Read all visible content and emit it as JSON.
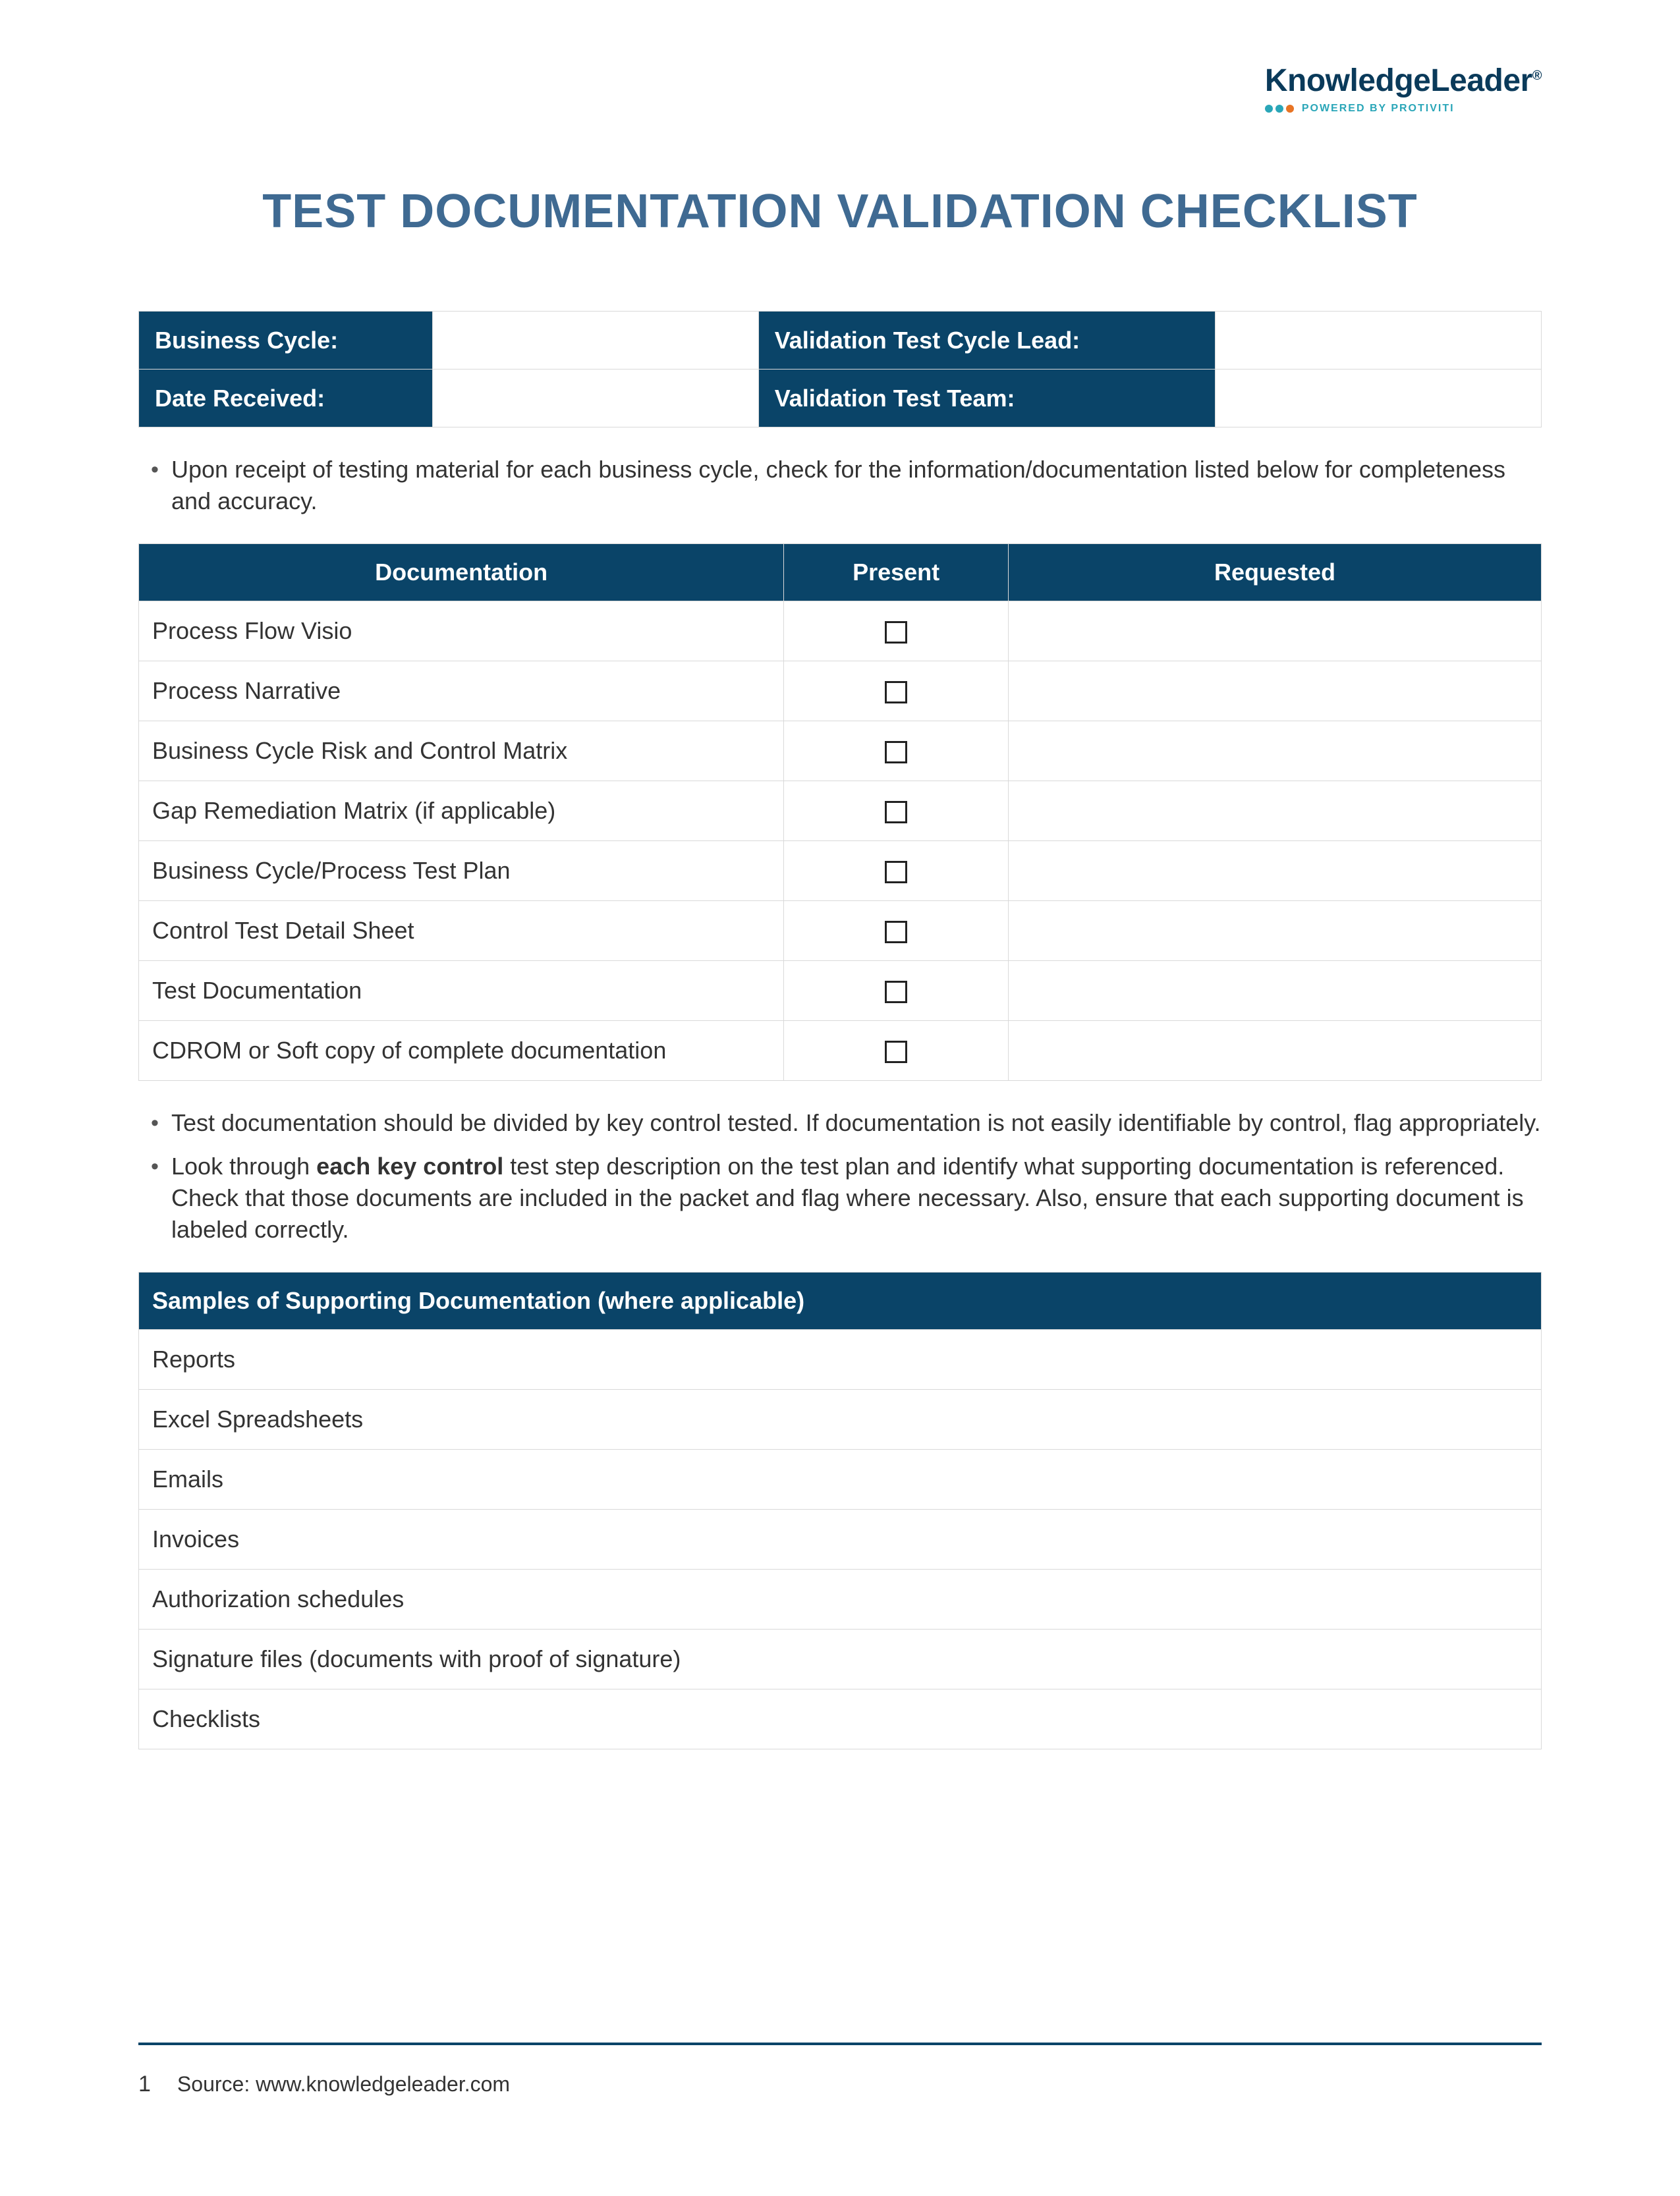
{
  "brand": {
    "main": "KnowledgeLeader",
    "reg": "®",
    "powered": "POWERED BY PROTIVITI",
    "dot_colors": [
      "#2aa6b8",
      "#2aa6b8",
      "#e87424"
    ]
  },
  "title": "TEST DOCUMENTATION VALIDATION CHECKLIST",
  "info": {
    "labels": {
      "business_cycle": "Business Cycle:",
      "date_received": "Date Received:",
      "lead": "Validation Test Cycle Lead:",
      "team": "Validation Test Team:"
    },
    "values": {
      "business_cycle": "",
      "date_received": "",
      "lead": "",
      "team": ""
    }
  },
  "bullets_top": [
    "Upon receipt of testing material for each business cycle, check for the information/documentation listed below for completeness and accuracy."
  ],
  "doc_table": {
    "headers": {
      "documentation": "Documentation",
      "present": "Present",
      "requested": "Requested"
    },
    "rows": [
      {
        "name": "Process Flow Visio",
        "requested": ""
      },
      {
        "name": "Process Narrative",
        "requested": ""
      },
      {
        "name": "Business Cycle Risk and Control Matrix",
        "requested": ""
      },
      {
        "name": "Gap Remediation Matrix (if applicable)",
        "requested": ""
      },
      {
        "name": "Business Cycle/Process Test Plan",
        "requested": ""
      },
      {
        "name": "Control Test Detail Sheet",
        "requested": ""
      },
      {
        "name": "Test Documentation",
        "requested": ""
      },
      {
        "name": "CDROM or Soft copy of complete documentation",
        "requested": ""
      }
    ]
  },
  "bullets_mid": [
    {
      "pre": "Test documentation should be divided by key control tested. If documentation is not easily identifiable by control, flag appropriately.",
      "bold": "",
      "post": ""
    },
    {
      "pre": "Look through ",
      "bold": "each key control",
      "post": " test step description on the test plan and identify what supporting documentation is referenced. Check that those documents are included in the packet and flag where necessary. Also, ensure that each supporting document is labeled correctly."
    }
  ],
  "samples": {
    "header": "Samples of Supporting Documentation (where applicable)",
    "rows": [
      "Reports",
      "Excel Spreadsheets",
      "Emails",
      "Invoices",
      "Authorization schedules",
      "Signature files (documents with proof of signature)",
      "Checklists"
    ]
  },
  "footer": {
    "page": "1",
    "source": "Source: www.knowledgeleader.com"
  }
}
